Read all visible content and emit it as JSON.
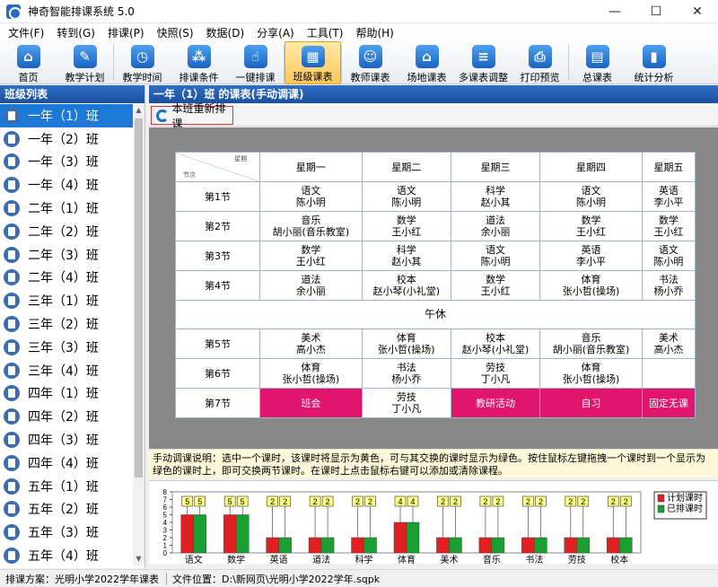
{
  "window": {
    "title": "神奇智能排课系统 5.0",
    "minimize": "—",
    "maximize": "☐",
    "close": "✕"
  },
  "menu": [
    "文件(F)",
    "转到(G)",
    "排课(P)",
    "快照(S)",
    "数据(D)",
    "分享(A)",
    "工具(T)",
    "帮助(H)"
  ],
  "toolbar": [
    {
      "label": "首页",
      "icon": "home-icon",
      "glyph": "⌂"
    },
    {
      "label": "教学计划",
      "icon": "clipboard-icon",
      "glyph": "✎"
    },
    {
      "label": "教学时间",
      "icon": "clock-icon",
      "glyph": "◷"
    },
    {
      "label": "排课条件",
      "icon": "conditions-icon",
      "glyph": "⁂"
    },
    {
      "label": "一键排课",
      "icon": "hand-click-icon",
      "glyph": "☝"
    },
    {
      "label": "班级课表",
      "icon": "calendar-icon",
      "glyph": "▦",
      "active": true
    },
    {
      "label": "教师课表",
      "icon": "teacher-icon",
      "glyph": "☺"
    },
    {
      "label": "场地课表",
      "icon": "building-icon",
      "glyph": "⌂"
    },
    {
      "label": "多课表调整",
      "icon": "multi-schedule-icon",
      "glyph": "≡"
    },
    {
      "label": "打印预览",
      "icon": "printer-icon",
      "glyph": "⎙"
    },
    {
      "label": "总课表",
      "icon": "summary-calendar-icon",
      "glyph": "▤"
    },
    {
      "label": "统计分析",
      "icon": "bar-chart-icon",
      "glyph": "▮"
    }
  ],
  "left_panel": {
    "title": "班级列表",
    "classes": [
      "一年（1）班",
      "一年（2）班",
      "一年（3）班",
      "一年（4）班",
      "二年（1）班",
      "二年（2）班",
      "二年（3）班",
      "二年（4）班",
      "三年（1）班",
      "三年（2）班",
      "三年（3）班",
      "三年（4）班",
      "四年（1）班",
      "四年（2）班",
      "四年（3）班",
      "四年（4）班",
      "五年（1）班",
      "五年（2）班",
      "五年（3）班",
      "五年（4）班"
    ],
    "selected_index": 0
  },
  "right_panel": {
    "title": "一年（1）班 的课表(手动调课)",
    "reschedule_button": "本班重新排课",
    "corner_top": "星期",
    "corner_bottom": "节次",
    "days": [
      "星期一",
      "星期二",
      "星期三",
      "星期四",
      "星期五"
    ],
    "lunch": "午休",
    "rows": [
      {
        "period": "第1节",
        "cells": [
          [
            "语文",
            "陈小明"
          ],
          [
            "语文",
            "陈小明"
          ],
          [
            "科学",
            "赵小其"
          ],
          [
            "语文",
            "陈小明"
          ],
          [
            "英语",
            "李小平"
          ]
        ]
      },
      {
        "period": "第2节",
        "cells": [
          [
            "音乐",
            "胡小丽(音乐教室)"
          ],
          [
            "数学",
            "王小红"
          ],
          [
            "道法",
            "余小丽"
          ],
          [
            "数学",
            "王小红"
          ],
          [
            "数学",
            "王小红"
          ]
        ]
      },
      {
        "period": "第3节",
        "cells": [
          [
            "数学",
            "王小红"
          ],
          [
            "科学",
            "赵小其"
          ],
          [
            "语文",
            "陈小明"
          ],
          [
            "英语",
            "李小平"
          ],
          [
            "语文",
            "陈小明"
          ]
        ]
      },
      {
        "period": "第4节",
        "cells": [
          [
            "道法",
            "余小丽"
          ],
          [
            "校本",
            "赵小琴(小礼堂)"
          ],
          [
            "数学",
            "王小红"
          ],
          [
            "体育",
            "张小哲(操场)"
          ],
          [
            "书法",
            "杨小乔"
          ]
        ]
      },
      {
        "period": "第5节",
        "cells": [
          [
            "美术",
            "高小杰"
          ],
          [
            "体育",
            "张小哲(操场)"
          ],
          [
            "校本",
            "赵小琴(小礼堂)"
          ],
          [
            "音乐",
            "胡小丽(音乐教室)"
          ],
          [
            "美术",
            "高小杰"
          ]
        ]
      },
      {
        "period": "第6节",
        "cells": [
          [
            "体育",
            "张小哲(操场)"
          ],
          [
            "书法",
            "杨小乔"
          ],
          [
            "劳技",
            "丁小凡"
          ],
          [
            "体育",
            "张小哲(操场)"
          ],
          [
            "",
            ""
          ]
        ]
      },
      {
        "period": "第7节",
        "cells": [
          [
            "班会",
            "",
            true
          ],
          [
            "劳技",
            "丁小凡"
          ],
          [
            "教研活动",
            "",
            true
          ],
          [
            "自习",
            "",
            true
          ],
          [
            "固定无课",
            "",
            true
          ]
        ]
      }
    ],
    "note": "手动调课说明：选中一个课时，该课时将显示为黄色，可与其交换的课时显示为绿色。按住鼠标左键拖拽一个课时到一个显示为绿色的课时上，即可交换两节课时。在课时上点击鼠标右键可以添加或清除课程。"
  },
  "chart_data": {
    "type": "bar",
    "categories": [
      "语文",
      "数学",
      "英语",
      "道法",
      "科学",
      "体育",
      "美术",
      "音乐",
      "书法",
      "劳技",
      "校本"
    ],
    "series": [
      {
        "name": "计划课时",
        "values": [
          5,
          5,
          2,
          2,
          2,
          4,
          2,
          2,
          2,
          2,
          2
        ],
        "color": "#e02020"
      },
      {
        "name": "已排课时",
        "values": [
          5,
          5,
          2,
          2,
          2,
          4,
          2,
          2,
          2,
          2,
          2
        ],
        "color": "#1aa030"
      }
    ],
    "ylim": [
      0,
      8
    ],
    "yticks": [
      0,
      1,
      2,
      3,
      4,
      5,
      6,
      7,
      8
    ],
    "legend_position": "right"
  },
  "status": {
    "scheme": "排课方案：光明小学2022学年课表",
    "file": "文件位置：D:\\新网页\\光明小学2022学年.sqpk"
  }
}
